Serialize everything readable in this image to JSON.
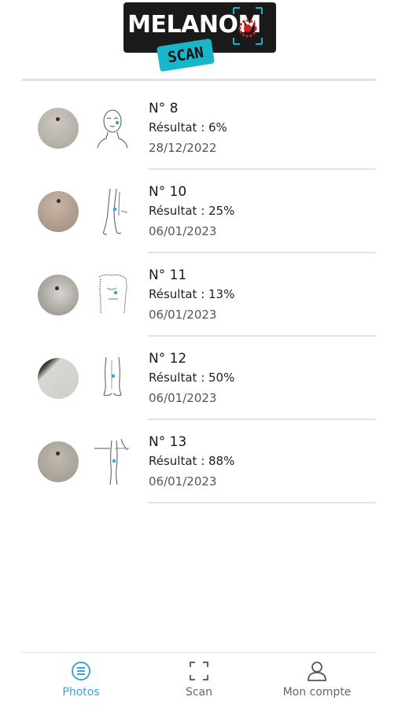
{
  "logo": {
    "word": "MELANOM",
    "badge": "SCAN"
  },
  "scans": [
    {
      "title": "N° 8",
      "result": "Résultat : 6%",
      "date": "28/12/2022",
      "body_icon": "head-face-icon",
      "thumb_color": "#bdb8b0"
    },
    {
      "title": "N° 10",
      "result": "Résultat : 25%",
      "date": "06/01/2023",
      "body_icon": "legs-icon",
      "thumb_color": "#b9a89a"
    },
    {
      "title": "N° 11",
      "result": "Résultat : 13%",
      "date": "06/01/2023",
      "body_icon": "torso-back-icon",
      "thumb_color": "#c4c2bc"
    },
    {
      "title": "N° 12",
      "result": "Résultat : 50%",
      "date": "06/01/2023",
      "body_icon": "lower-legs-icon",
      "thumb_color": "#d4d2cc"
    },
    {
      "title": "N° 13",
      "result": "Résultat : 88%",
      "date": "06/01/2023",
      "body_icon": "arm-side-icon",
      "thumb_color": "#b2aca2"
    }
  ],
  "nav": {
    "photos": "Photos",
    "scan": "Scan",
    "account": "Mon compte"
  },
  "colors": {
    "accent": "#3ba4d6",
    "marker": "#2aa8d8",
    "badge": "#18b6c8"
  }
}
